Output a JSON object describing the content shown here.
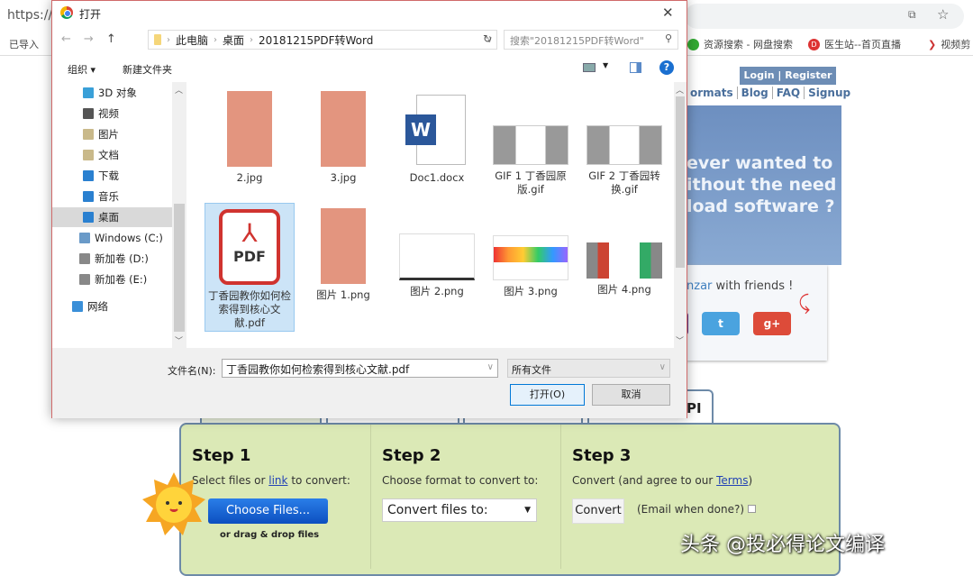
{
  "browser": {
    "url": "https://",
    "bookmarks": [
      "已导入",
      "资源搜索 - 网盘搜索",
      "医生站--首页直播",
      "视频剪"
    ]
  },
  "site": {
    "login": "Login | Register",
    "nav": [
      "ormats",
      "Blog",
      "FAQ",
      "Signup"
    ],
    "banner": [
      "ever wanted to",
      "ithout the need",
      "load software ?"
    ],
    "share_brand": "nzar",
    "share_rest": " with friends !",
    "social": {
      "twitter": "t",
      "gplus": "g+"
    },
    "tab_api": "PI",
    "steps": [
      {
        "title": "Step 1",
        "desc_pre": "Select files or ",
        "desc_link": "link",
        "desc_post": " to convert:",
        "button": "Choose Files...",
        "hint": "or drag & drop files"
      },
      {
        "title": "Step 2",
        "desc": "Choose format to convert to:",
        "select": "Convert files to:"
      },
      {
        "title": "Step 3",
        "desc_pre": "Convert (and agree to our ",
        "desc_link": "Terms",
        "desc_post": ")",
        "button": "Convert",
        "email": "(Email when done?)"
      }
    ],
    "watermark": "头条 @投必得论文编译"
  },
  "dialog": {
    "title": "打开",
    "path": [
      "此电脑",
      "桌面",
      "20181215PDF转Word"
    ],
    "search_placeholder": "搜索\"20181215PDF转Word\"",
    "toolbar": {
      "organize": "组织 ▾",
      "new_folder": "新建文件夹"
    },
    "nav": [
      {
        "label": "3D 对象",
        "color": "#3aa0d8"
      },
      {
        "label": "视频",
        "color": "#555"
      },
      {
        "label": "图片",
        "color": "#c9b98a"
      },
      {
        "label": "文档",
        "color": "#c9b98a"
      },
      {
        "label": "下载",
        "color": "#2a80d0"
      },
      {
        "label": "音乐",
        "color": "#2a80d0"
      },
      {
        "label": "桌面",
        "color": "#2a80d0",
        "selected": true
      },
      {
        "label": "Windows (C:)",
        "color": "#6a9ac8"
      },
      {
        "label": "新加卷 (D:)",
        "color": "#888"
      },
      {
        "label": "新加卷 (E:)",
        "color": "#888"
      },
      {
        "label": "网络",
        "color": "#3a8fd8"
      }
    ],
    "files": [
      {
        "name": "2.jpg",
        "type": "jpg"
      },
      {
        "name": "3.jpg",
        "type": "jpg"
      },
      {
        "name": "Doc1.docx",
        "type": "docx"
      },
      {
        "name": "GIF 1 丁香园原版.gif",
        "type": "gif"
      },
      {
        "name": "GIF 2 丁香园转换.gif",
        "type": "gif"
      },
      {
        "name": "丁香园教你如何检索得到核心文献.pdf",
        "type": "pdf",
        "selected": true
      },
      {
        "name": "图片 1.png",
        "type": "jpg"
      },
      {
        "name": "图片 2.png",
        "type": "png"
      },
      {
        "name": "图片 3.png",
        "type": "png3"
      },
      {
        "name": "图片 4.png",
        "type": "png4"
      }
    ],
    "pdf_label": "PDF",
    "word_label": "W",
    "filename_label": "文件名(N):",
    "filename_value": "丁香园教你如何检索得到核心文献.pdf",
    "filter": "所有文件",
    "open": "打开(O)",
    "cancel": "取消"
  }
}
